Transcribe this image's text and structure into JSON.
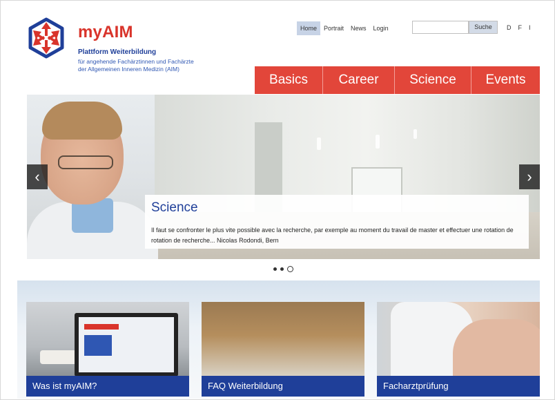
{
  "brand": {
    "name": "myAIM",
    "tagline": "Plattform Weiterbildung",
    "sub_line1": "für angehende Fachärztinnen und Fachärzte",
    "sub_line2": "der Allgemeinen Inneren Medizin (AIM)",
    "logo_icon": "arrows-star-logo-icon"
  },
  "topnav": {
    "links": [
      "Home",
      "Portrait",
      "News",
      "Login"
    ],
    "active": "Home",
    "search_value": "",
    "search_button": "Suche",
    "languages": [
      "D",
      "F",
      "I"
    ]
  },
  "mainnav": {
    "items": [
      "Basics",
      "Career",
      "Science",
      "Events"
    ]
  },
  "hero": {
    "title": "Science",
    "text": "Il faut se confronter le plus vite possible avec la recherche, par exemple au moment du travail de master et effectuer une rotation de rotation de recherche... Nicolas Rodondi, Bern",
    "prev_icon": "‹",
    "next_icon": "›",
    "slide_count": 3,
    "active_slide": 3
  },
  "cards": [
    {
      "label": "Was ist myAIM?"
    },
    {
      "label": "FAQ Weiterbildung"
    },
    {
      "label": "Facharztprüfung"
    }
  ],
  "colors": {
    "accent_red": "#e2463a",
    "brand_blue": "#1f3f99",
    "active_nav_bg": "#c7d3e6"
  }
}
